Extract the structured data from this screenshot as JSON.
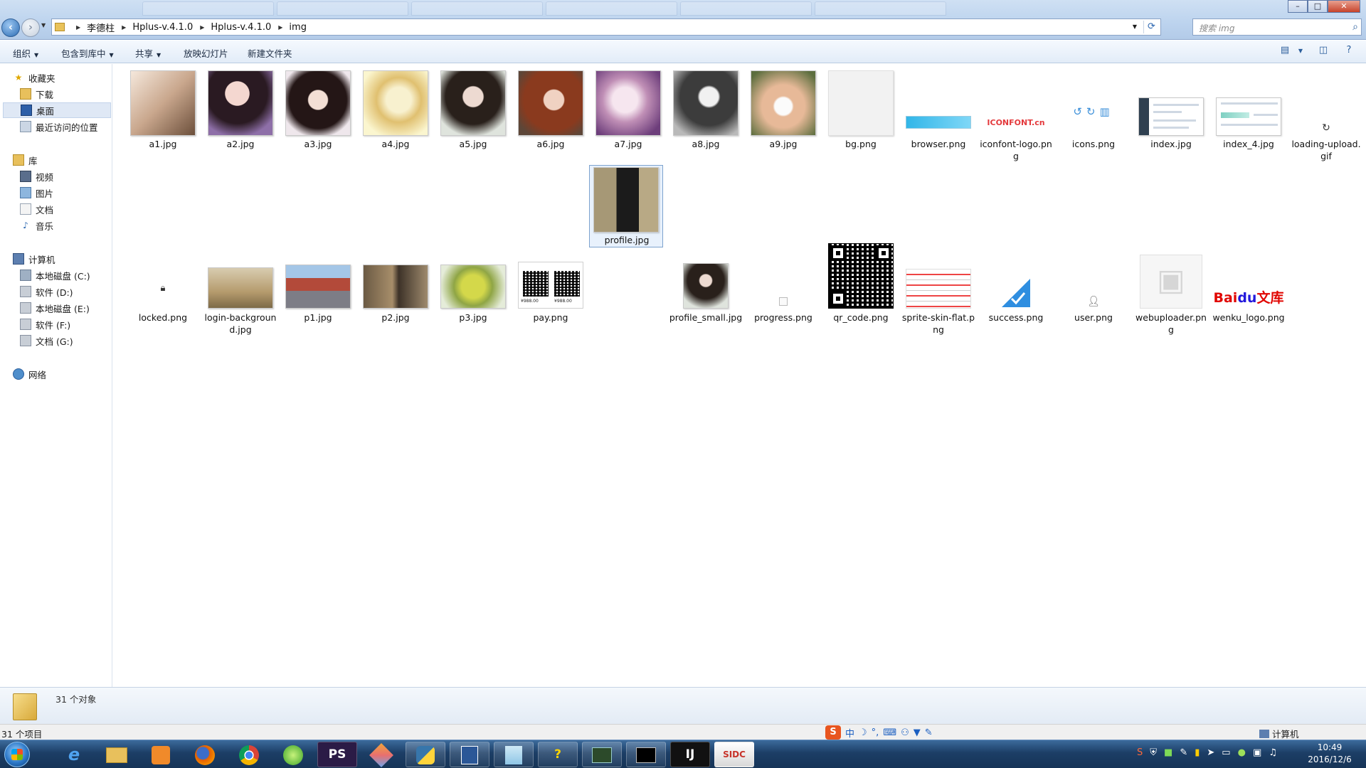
{
  "window": {
    "controls": {
      "minimize": "–",
      "maximize": "□",
      "close": "✕"
    }
  },
  "address": {
    "crumbs": [
      "李德柱",
      "Hplus-v.4.1.0",
      "Hplus-v.4.1.0",
      "img"
    ]
  },
  "search": {
    "placeholder": "搜索 img"
  },
  "toolbar": {
    "organize": "组织",
    "include_in_library": "包含到库中",
    "share": "共享",
    "slideshow": "放映幻灯片",
    "new_folder": "新建文件夹"
  },
  "sidebar": {
    "favorites": "收藏夹",
    "downloads": "下载",
    "desktop": "桌面",
    "recent": "最近访问的位置",
    "libraries": "库",
    "videos": "视频",
    "pictures": "图片",
    "documents": "文档",
    "music": "音乐",
    "computer": "计算机",
    "drives": [
      "本地磁盘 (C:)",
      "软件 (D:)",
      "本地磁盘 (E:)",
      "软件 (F:)",
      "文档 (G:)"
    ],
    "network": "网络"
  },
  "files": [
    "a1.jpg",
    "a2.jpg",
    "a3.jpg",
    "a4.jpg",
    "a5.jpg",
    "a6.jpg",
    "a7.jpg",
    "a8.jpg",
    "a9.jpg",
    "bg.png",
    "browser.png",
    "iconfont-logo.png",
    "icons.png",
    "index.jpg",
    "index_4.jpg",
    "loading-upload.gif",
    "locked.png",
    "login-background.jpg",
    "p1.jpg",
    "p2.jpg",
    "p3.jpg",
    "pay.png",
    "profile.jpg",
    "profile_small.jpg",
    "progress.png",
    "qr_code.png",
    "sprite-skin-flat.png",
    "success.png",
    "user.png",
    "webuploader.png",
    "wenku_logo.png"
  ],
  "file_labels": {
    "iconfont": "ICONFONT.cn",
    "baidu_bai": "Bai",
    "baidu_du": "du",
    "baidu_wenku": "文库",
    "pay_left": "¥988.00",
    "pay_right": "¥988.00"
  },
  "details": {
    "count": "31 个对象"
  },
  "statusbar": {
    "items": "31 个项目",
    "location": "计算机",
    "ime": {
      "brand": "S",
      "mode": "中"
    }
  },
  "taskbar": {
    "apps": [
      "e",
      "PS",
      "?",
      "IJ",
      "SIDC"
    ],
    "clock_time": "10:49",
    "clock_date": "2016/12/6"
  },
  "colors": {
    "accent": "#2c6cb3",
    "selection": "#e8f1fc",
    "taskbar": "#1c3e66"
  }
}
